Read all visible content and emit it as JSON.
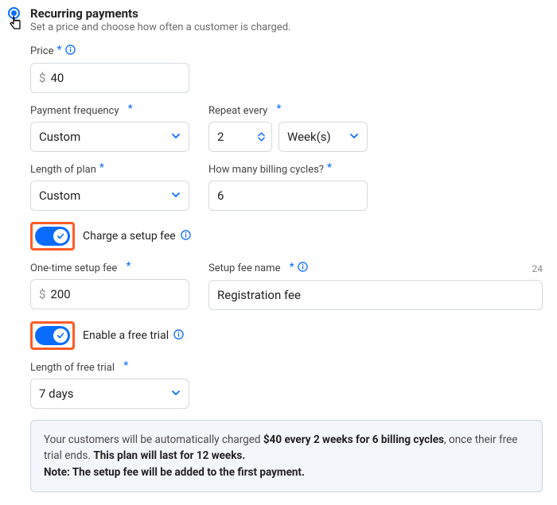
{
  "header": {
    "title": "Recurring payments",
    "subtitle": "Set a price and choose how often a customer is charged."
  },
  "price": {
    "label": "Price",
    "currency": "$",
    "value": "40"
  },
  "frequency": {
    "label": "Payment frequency",
    "value": "Custom"
  },
  "repeat": {
    "label": "Repeat every",
    "count": "2",
    "unit": "Week(s)"
  },
  "length_plan": {
    "label": "Length of plan",
    "value": "Custom"
  },
  "billing_cycles": {
    "label": "How many billing cycles?",
    "value": "6"
  },
  "setup_fee_toggle": {
    "label": "Charge a setup fee"
  },
  "setup_fee": {
    "label": "One-time setup fee",
    "currency": "$",
    "value": "200"
  },
  "setup_fee_name": {
    "label": "Setup fee name",
    "value": "Registration fee",
    "remaining": "24"
  },
  "free_trial_toggle": {
    "label": "Enable a free trial"
  },
  "free_trial_length": {
    "label": "Length of free trial",
    "value": "7 days"
  },
  "summary": {
    "pre": "Your customers will be automatically charged ",
    "terms": "$40 every 2 weeks for 6 billing cycles",
    "mid": ", once their free trial ends. ",
    "plan": "This plan will last for 12 weeks.",
    "note_label": "Note: The setup fee will be added to the first payment."
  }
}
